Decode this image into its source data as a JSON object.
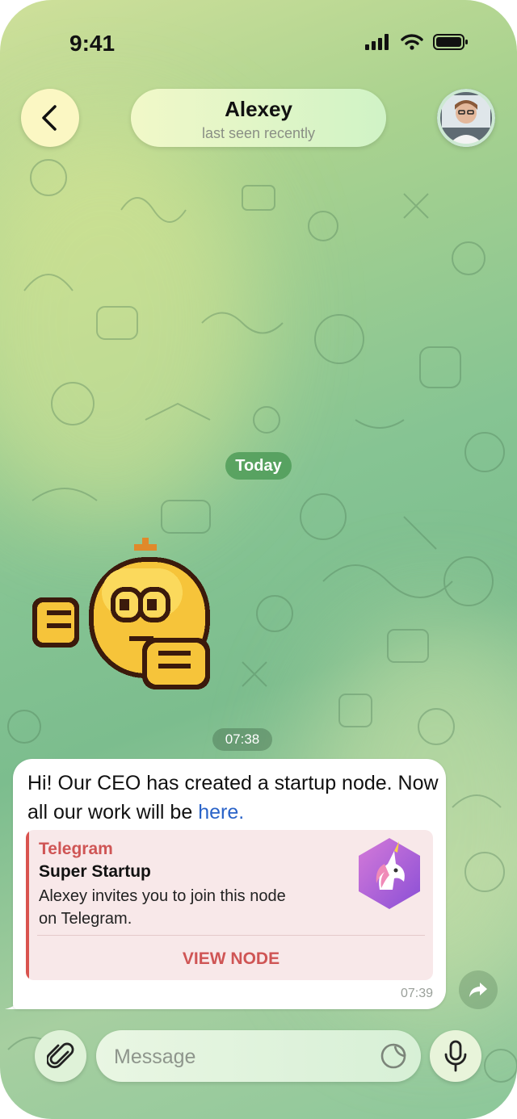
{
  "status": {
    "time": "9:41"
  },
  "header": {
    "back_icon": "chevron-left-icon",
    "name": "Alexey",
    "status": "last seen recently"
  },
  "chat": {
    "date_label": "Today",
    "sticker_time": "07:38",
    "message": {
      "text_before_link": "Hi! Our CEO has created a startup node. Now all our work will be ",
      "link_text": "here.",
      "time": "07:39",
      "preview": {
        "site": "Telegram",
        "title": "Super Startup",
        "description": "Alexey invites you to join this node on Telegram.",
        "button": "VIEW NODE",
        "accent": "#cf5555"
      }
    }
  },
  "composer": {
    "placeholder": "Message",
    "attach_icon": "paperclip-icon",
    "sticker_icon": "sticker-icon",
    "mic_icon": "microphone-icon"
  }
}
